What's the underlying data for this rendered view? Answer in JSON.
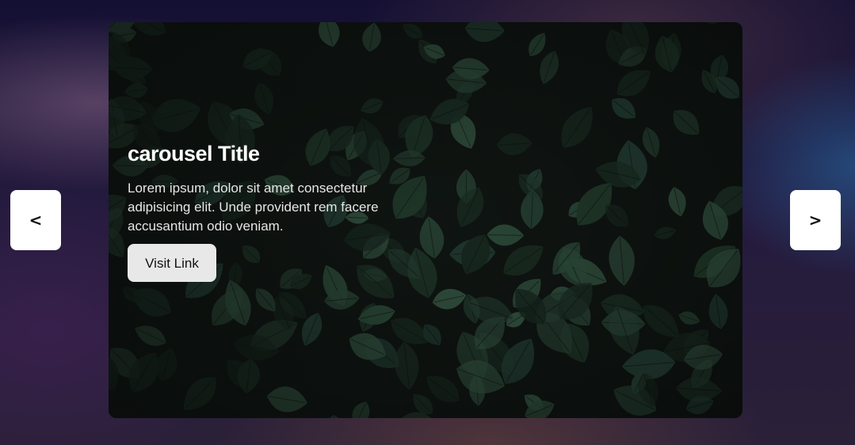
{
  "carousel": {
    "title": "carousel Title",
    "description": "Lorem ipsum, dolor sit amet consectetur adipisicing elit. Unde provident rem facere accusantium odio veniam.",
    "link_label": "Visit Link",
    "background_image": "dark-green-leaves-photo"
  },
  "navigation": {
    "prev_label": "<",
    "next_label": ">"
  },
  "colors": {
    "page_background": "#1c1538",
    "leaf_dark": "#0f1512",
    "leaf_green": "#2c4a3a",
    "button_bg": "#e8e8e8",
    "nav_bg": "#ffffff"
  }
}
